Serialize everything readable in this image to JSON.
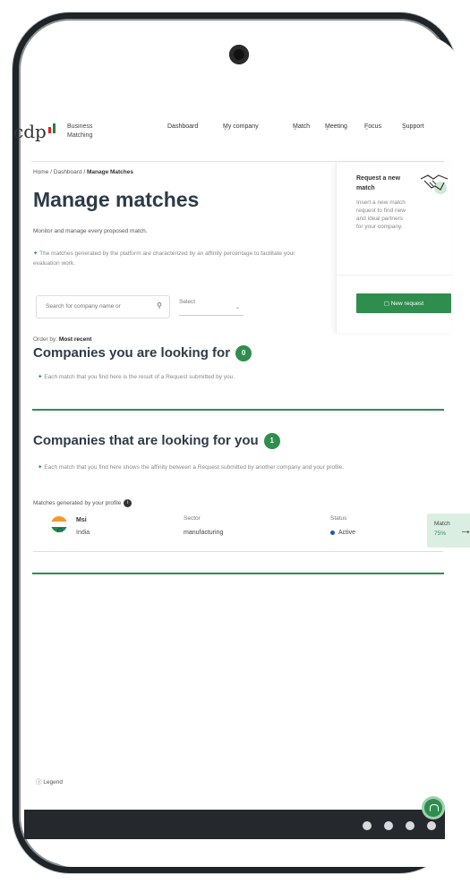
{
  "brand": {
    "name": "cdp",
    "subtitle": "Business Matching"
  },
  "nav": {
    "items": [
      {
        "label": "Dashboard",
        "dropdown": false
      },
      {
        "label": "My company",
        "dropdown": true
      },
      {
        "label": "Match",
        "dropdown": true
      },
      {
        "label": "Meeting",
        "dropdown": true
      },
      {
        "label": "Focus",
        "dropdown": true
      },
      {
        "label": "Support",
        "dropdown": true
      }
    ]
  },
  "breadcrumb": {
    "path": "Home / Dashboard / ",
    "current": "Manage Matches"
  },
  "page": {
    "title": "Manage matches",
    "subtitle": "Monitor and manage every proposed match.",
    "note": "The matches generated by the platform are characterized by an affinity percentage to facilitate your evaluation work."
  },
  "filters": {
    "search_placeholder": "Search for company name or",
    "select_label": "Select"
  },
  "order": {
    "label": "Order by:",
    "value": "Most recent"
  },
  "sections": {
    "looking_for": {
      "title": "Companies you are looking for",
      "count": "0",
      "note": "Each match that you find here is the result of a Request submitted by you."
    },
    "looking_for_you": {
      "title": "Companies that are looking for you",
      "count": "1",
      "note": "Each match that you find here shows the affinity between a Request submitted by another company and your profile."
    }
  },
  "profile_matches": {
    "label": "Matches generated by your profile",
    "info": "i",
    "rows": [
      {
        "company": "Msi",
        "country": "India",
        "sector_label": "Sector",
        "sector": "manufacturing",
        "status_label": "Status",
        "status": "Active",
        "match_label": "Match",
        "match_value": "75%"
      }
    ]
  },
  "request_panel": {
    "title": "Request a new match",
    "description": "Insert a new match request to find new and ideal partners for your company.",
    "button_label": "New request"
  },
  "legend_label": "Legend",
  "colors": {
    "accent": "#2f8d4e",
    "footer": "#25292d",
    "title": "#2e3b48"
  }
}
